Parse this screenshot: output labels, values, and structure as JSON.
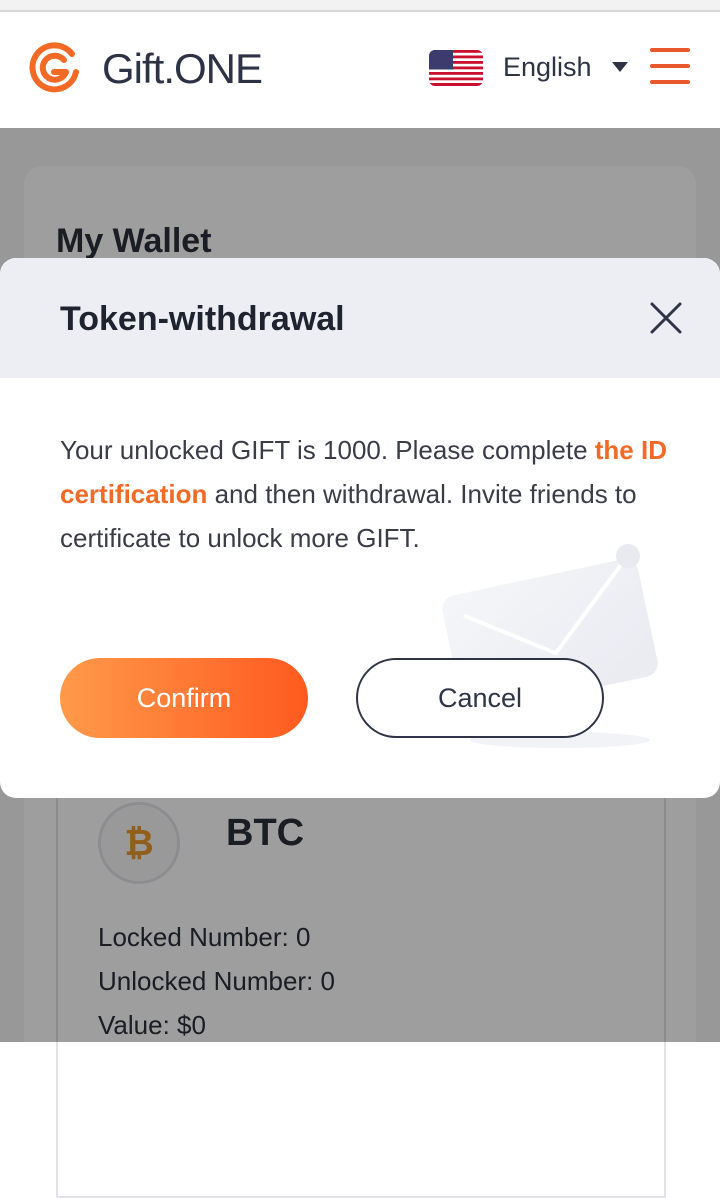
{
  "header": {
    "brand": "Gift.ONE",
    "language": "English",
    "flag_icon": "us-flag-icon",
    "menu_icon": "hamburger-menu-icon",
    "accent_color": "#e8582a"
  },
  "page": {
    "title": "My Wallet",
    "coin": {
      "name": "BTC",
      "icon": "bitcoin-icon",
      "locked": "Locked Number: 0",
      "unlocked": "Unlocked Number: 0",
      "value": "Value: $0"
    }
  },
  "modal": {
    "title": "Token-withdrawal",
    "close_icon": "close-icon",
    "message_part1": "Your unlocked GIFT is 1000. Please complete ",
    "message_link": "the ID certification",
    "message_part2": " and then withdrawal. Invite friends to certificate to unlock more GIFT.",
    "confirm_label": "Confirm",
    "cancel_label": "Cancel",
    "highlight_color": "#f26a25"
  }
}
